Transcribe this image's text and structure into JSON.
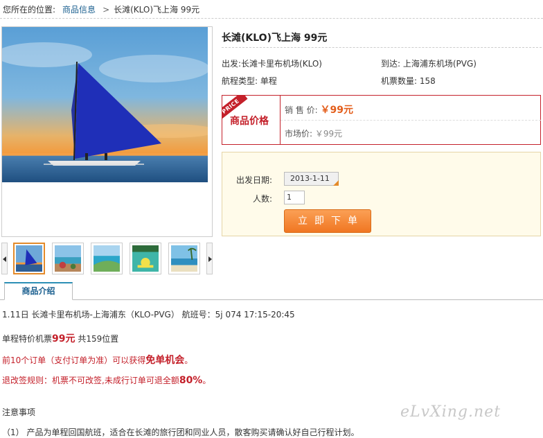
{
  "breadcrumb": {
    "prefix": "您所在的位置:",
    "link": "商品信息",
    "separator": ">",
    "current": "长滩(KLO)飞上海 99元"
  },
  "product": {
    "title": "长滩(KLO)飞上海 99元",
    "from": "出发:长滩卡里布机场(KLO)",
    "to": "到达: 上海浦东机场(PVG)",
    "trip_type": "航程类型: 单程",
    "ticket_count": "机票数量: 158"
  },
  "price": {
    "ribbon": "PRICE",
    "label": "商品价格",
    "sale_label": "销 售 价:",
    "sale_value": "￥99元",
    "market_label": "市场价:",
    "market_value": "￥99元"
  },
  "order": {
    "date_label": "出发日期:",
    "date_value": "2013-1-11",
    "qty_label": "人数:",
    "qty_value": "1",
    "button": "立即下单"
  },
  "tabs": [
    {
      "label": "商品介绍"
    }
  ],
  "description": {
    "line1": "1.11日 长滩卡里布机场-上海浦东（KLO-PVG） 航班号：5j 074 17:15-20:45",
    "line2_a": "单程特价机票",
    "line2_price": "99元",
    "line2_b": " 共159位置",
    "line3_a": "前10个订单（支付订单为准）可以获得",
    "line3_big": "免单机会",
    "line3_b": "。",
    "line4_a": "退改签规则：机票不可改签,未成行订单可退全额",
    "line4_big": "80%",
    "line4_b": "。",
    "notes_title": "注意事项",
    "note1": "（1） 产品为单程回国航班，适合在长滩的旅行团和同业人员，散客购买请确认好自己行程计划。"
  },
  "watermark": "eLvXing.net",
  "colors": {
    "accent_red": "#c4202a",
    "accent_orange": "#f07622",
    "link_blue": "#1a5f8f"
  }
}
